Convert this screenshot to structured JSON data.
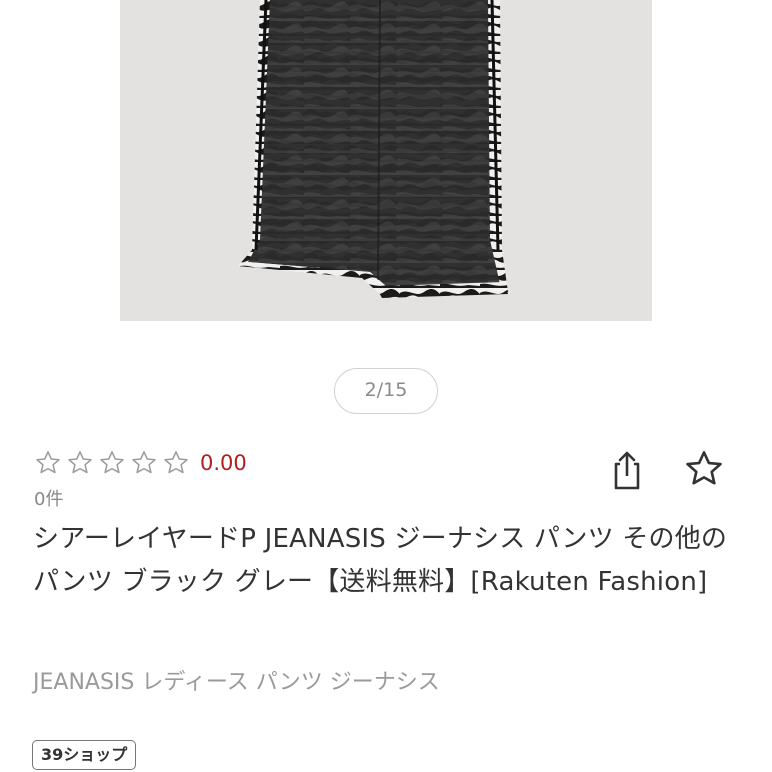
{
  "product": {
    "image_alt": "black sheer layered wide pants with zebra print lining",
    "image_counter": "2/15",
    "rating": {
      "stars_filled": 0,
      "stars_total": 5,
      "score": "0.00",
      "review_count": "0件"
    },
    "title": "シアーレイヤードP JEANASIS ジーナシス パンツ その他のパンツ ブラック グレー【送料無料】[Rakuten Fashion]",
    "subtitle": "JEANASIS レディース パンツ ジーナシス",
    "badge": "39ショップ"
  },
  "actions": {
    "share_icon": "share-icon",
    "favorite_icon": "star-outline-icon"
  },
  "colors": {
    "score_red": "#b01e1e",
    "photo_bg": "#e4e2e1",
    "muted_text": "#9a9a9a"
  }
}
